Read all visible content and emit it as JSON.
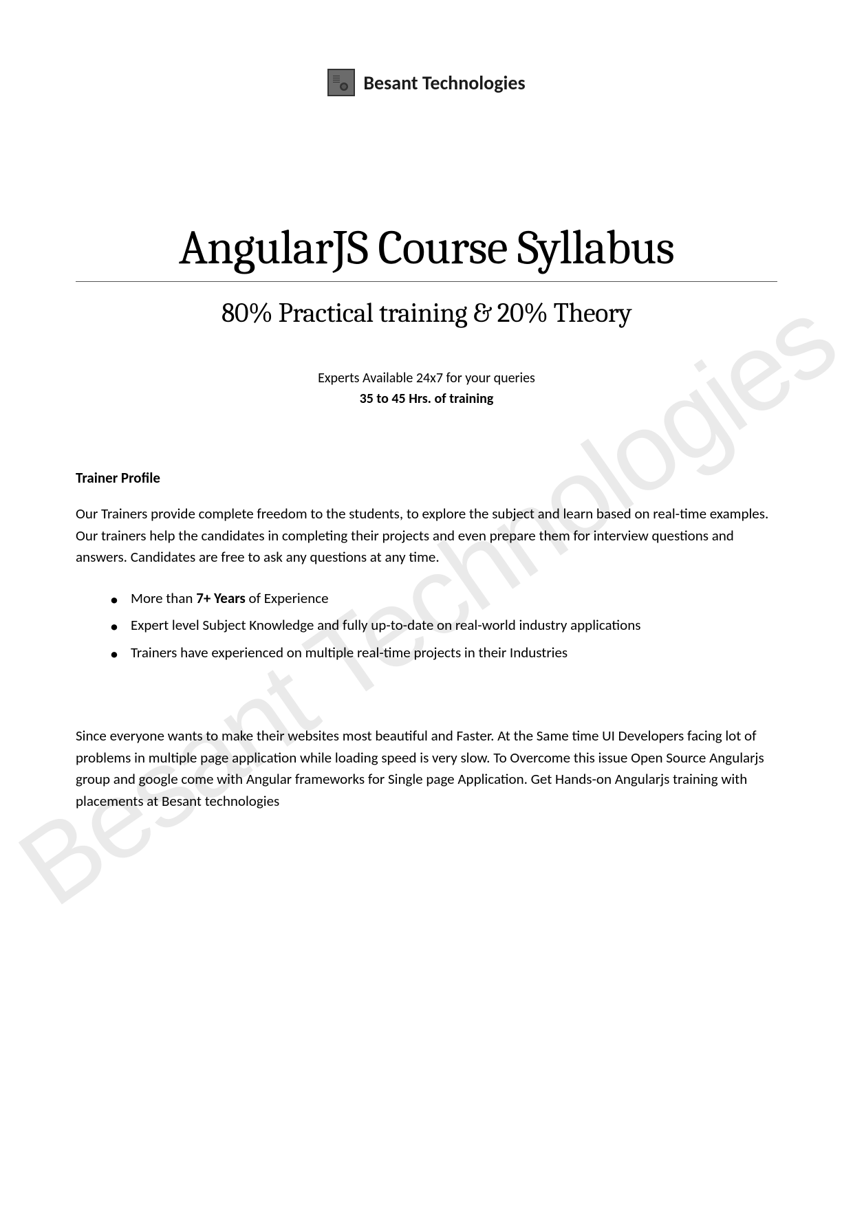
{
  "logo": {
    "company_name": "Besant Technologies"
  },
  "title": "AngularJS Course Syllabus",
  "subtitle": "80% Practical training & 20% Theory",
  "info": {
    "availability": "Experts Available 24x7 for your queries",
    "duration": "35 to 45 Hrs. of training"
  },
  "trainer_profile": {
    "heading": "Trainer Profile",
    "description": "Our Trainers provide complete freedom to the students, to explore the subject and learn based on real-time examples. Our trainers help the candidates in completing their projects and even prepare them for interview questions and answers. Candidates are free to ask any questions at any time.",
    "bullets": [
      {
        "prefix": "More than ",
        "bold": "7+ Years",
        "suffix": " of Experience"
      },
      {
        "prefix": "",
        "bold": "",
        "suffix": "Expert level Subject Knowledge and fully up-to-date on real-world industry applications"
      },
      {
        "prefix": "",
        "bold": "",
        "suffix": "Trainers have experienced on multiple real-time projects in their Industries"
      }
    ]
  },
  "closing_paragraph": "Since everyone wants to make their websites most beautiful and Faster. At the Same time UI Developers facing lot of problems in multiple page application while loading speed is very slow. To Overcome this issue Open Source Angularjs group and google come with Angular frameworks for Single page Application. Get Hands-on Angularjs training with placements at Besant technologies",
  "watermark": "Besant Technologies"
}
